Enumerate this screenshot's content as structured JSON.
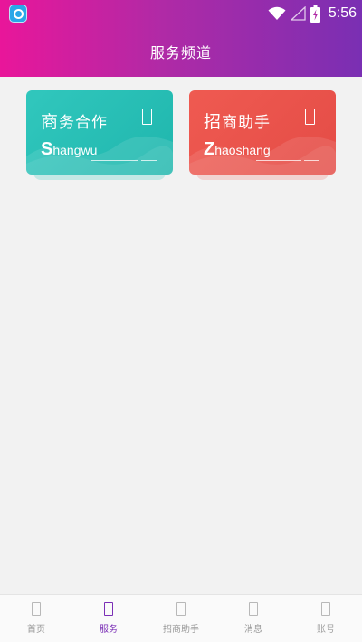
{
  "status_bar": {
    "time": "5:56",
    "icons": [
      "app-badge-icon",
      "wifi-icon",
      "signal-icon",
      "battery-charging-icon"
    ]
  },
  "header": {
    "title": "服务频道"
  },
  "cards": [
    {
      "title_first": "商",
      "title_rest": "务合作",
      "pinyin_first": "S",
      "pinyin_rest": "hangwu",
      "icon": "document-icon",
      "color": "#2bbfb6"
    },
    {
      "title_first": "招",
      "title_rest": "商助手",
      "pinyin_first": "Z",
      "pinyin_rest": "haoshang",
      "icon": "document-icon",
      "color": "#ea554d"
    }
  ],
  "bottom_nav": {
    "active_color": "#7b2fb6",
    "items": [
      {
        "label": "首页",
        "icon": "home-icon",
        "active": false
      },
      {
        "label": "服务",
        "icon": "service-icon",
        "active": true
      },
      {
        "label": "招商助手",
        "icon": "assistant-icon",
        "active": false
      },
      {
        "label": "消息",
        "icon": "message-icon",
        "active": false
      },
      {
        "label": "账号",
        "icon": "account-icon",
        "active": false
      }
    ]
  }
}
